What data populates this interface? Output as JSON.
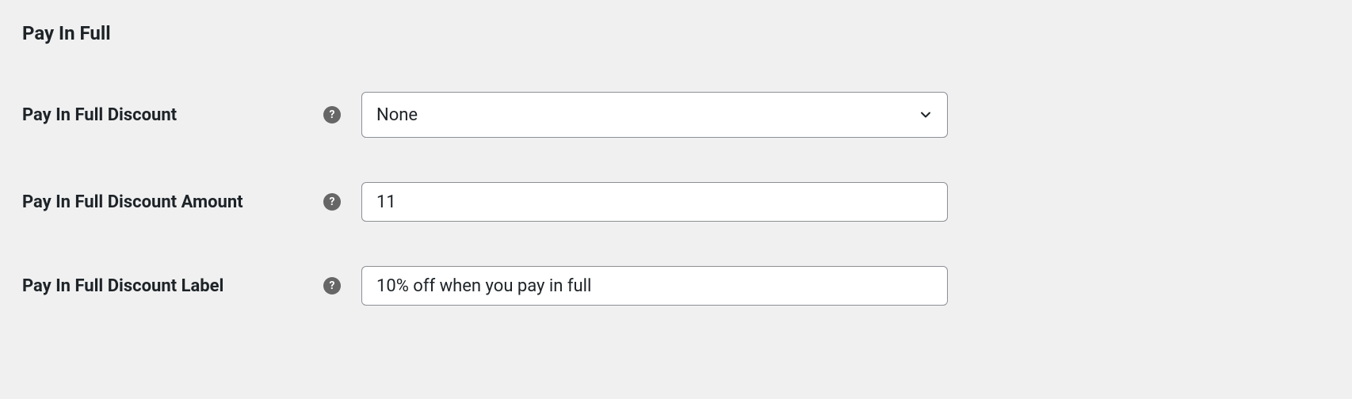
{
  "section": {
    "title": "Pay In Full"
  },
  "fields": {
    "discount": {
      "label": "Pay In Full Discount",
      "value": "None"
    },
    "amount": {
      "label": "Pay In Full Discount Amount",
      "value": "11"
    },
    "display_label": {
      "label": "Pay In Full Discount Label",
      "value": "10% off when you pay in full"
    }
  }
}
